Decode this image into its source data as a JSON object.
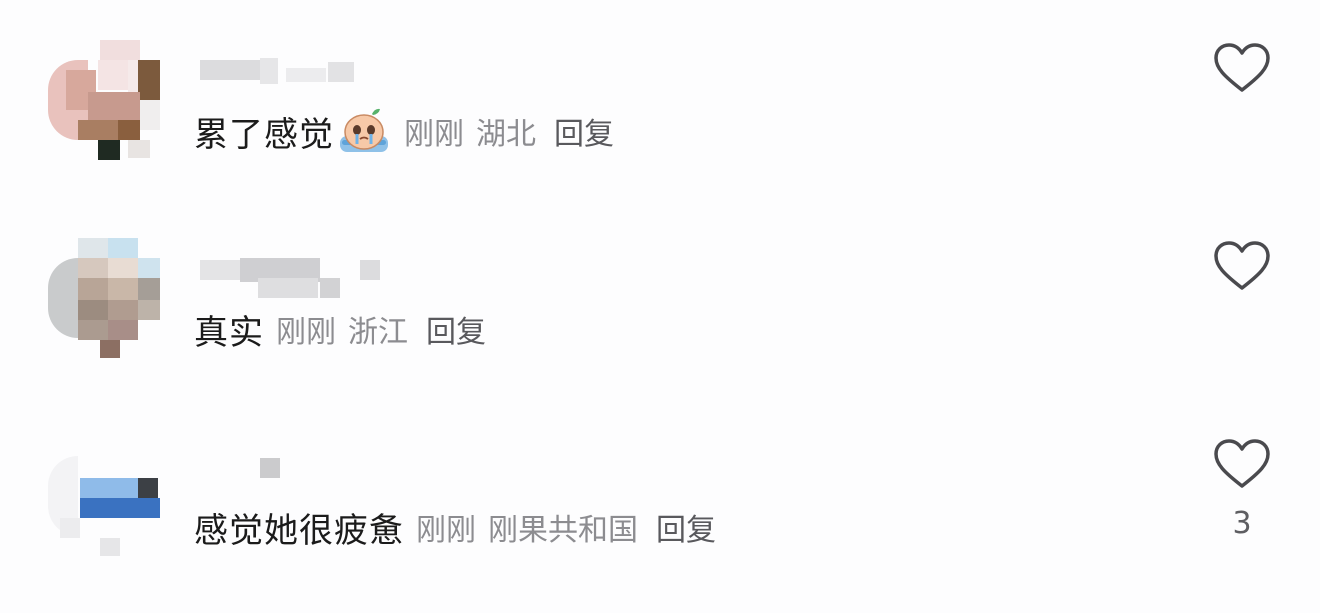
{
  "comments": [
    {
      "content": "累了感觉",
      "emoji": "crying-face-emoji",
      "time": "刚刚",
      "location": "湖北",
      "reply_label": "回复",
      "likes": null
    },
    {
      "content": "真实",
      "time": "刚刚",
      "location": "浙江",
      "reply_label": "回复",
      "likes": null
    },
    {
      "content": "感觉她很疲惫",
      "time": "刚刚",
      "location": "刚果共和国",
      "reply_label": "回复",
      "likes": "3"
    }
  ],
  "icons": {
    "like": "heart-outline-icon"
  },
  "colors": {
    "content_text": "#1b1b1b",
    "meta_text": "#8c8c90",
    "reply_text": "#59595d",
    "heart_stroke": "#4a4a4e"
  }
}
